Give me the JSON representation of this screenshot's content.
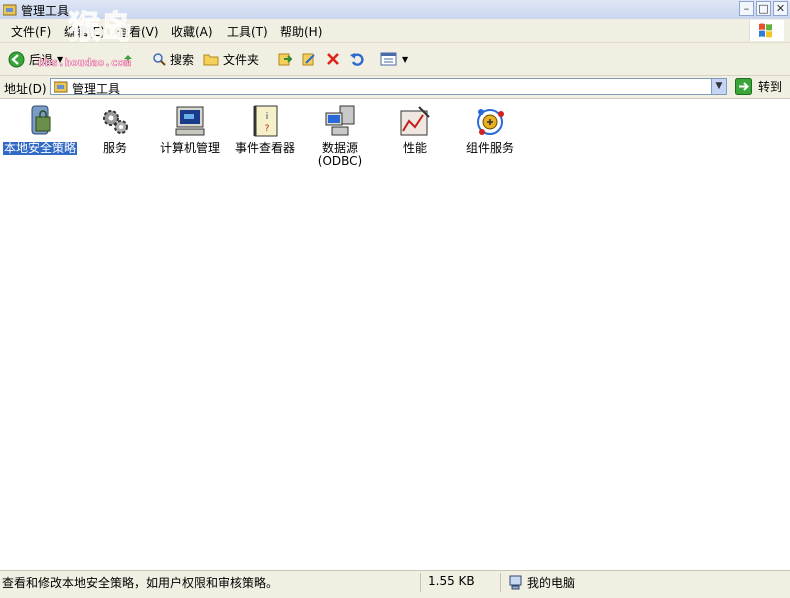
{
  "window": {
    "title": "管理工具"
  },
  "menu": [
    "文件(F)",
    "编辑(E)",
    "查看(V)",
    "收藏(A)",
    "工具(T)",
    "帮助(H)"
  ],
  "toolbar": {
    "back": "后退",
    "search": "搜索",
    "folders": "文件夹"
  },
  "address": {
    "label": "地址(D)",
    "value": "管理工具",
    "go": "转到"
  },
  "items": [
    {
      "label": "本地安全策略",
      "icon": "local-security-policy-icon",
      "selected": true
    },
    {
      "label": "服务",
      "icon": "services-gears-icon",
      "selected": false
    },
    {
      "label": "计算机管理",
      "icon": "computer-management-icon",
      "selected": false
    },
    {
      "label": "事件查看器",
      "icon": "event-viewer-icon",
      "selected": false
    },
    {
      "label": "数据源(ODBC)",
      "icon": "data-sources-icon",
      "selected": false
    },
    {
      "label": "性能",
      "icon": "performance-icon",
      "selected": false
    },
    {
      "label": "组件服务",
      "icon": "component-services-icon",
      "selected": false
    }
  ],
  "status": {
    "description": "查看和修改本地安全策略，如用户权限和审核策略。",
    "size": "1.55 KB",
    "zone": "我的电脑"
  },
  "watermark": {
    "text1": "猴岛",
    "text2": "bbs.houdao.com"
  },
  "colors": {
    "selection": "#316ac5",
    "window_bg": "#f1efe2"
  }
}
